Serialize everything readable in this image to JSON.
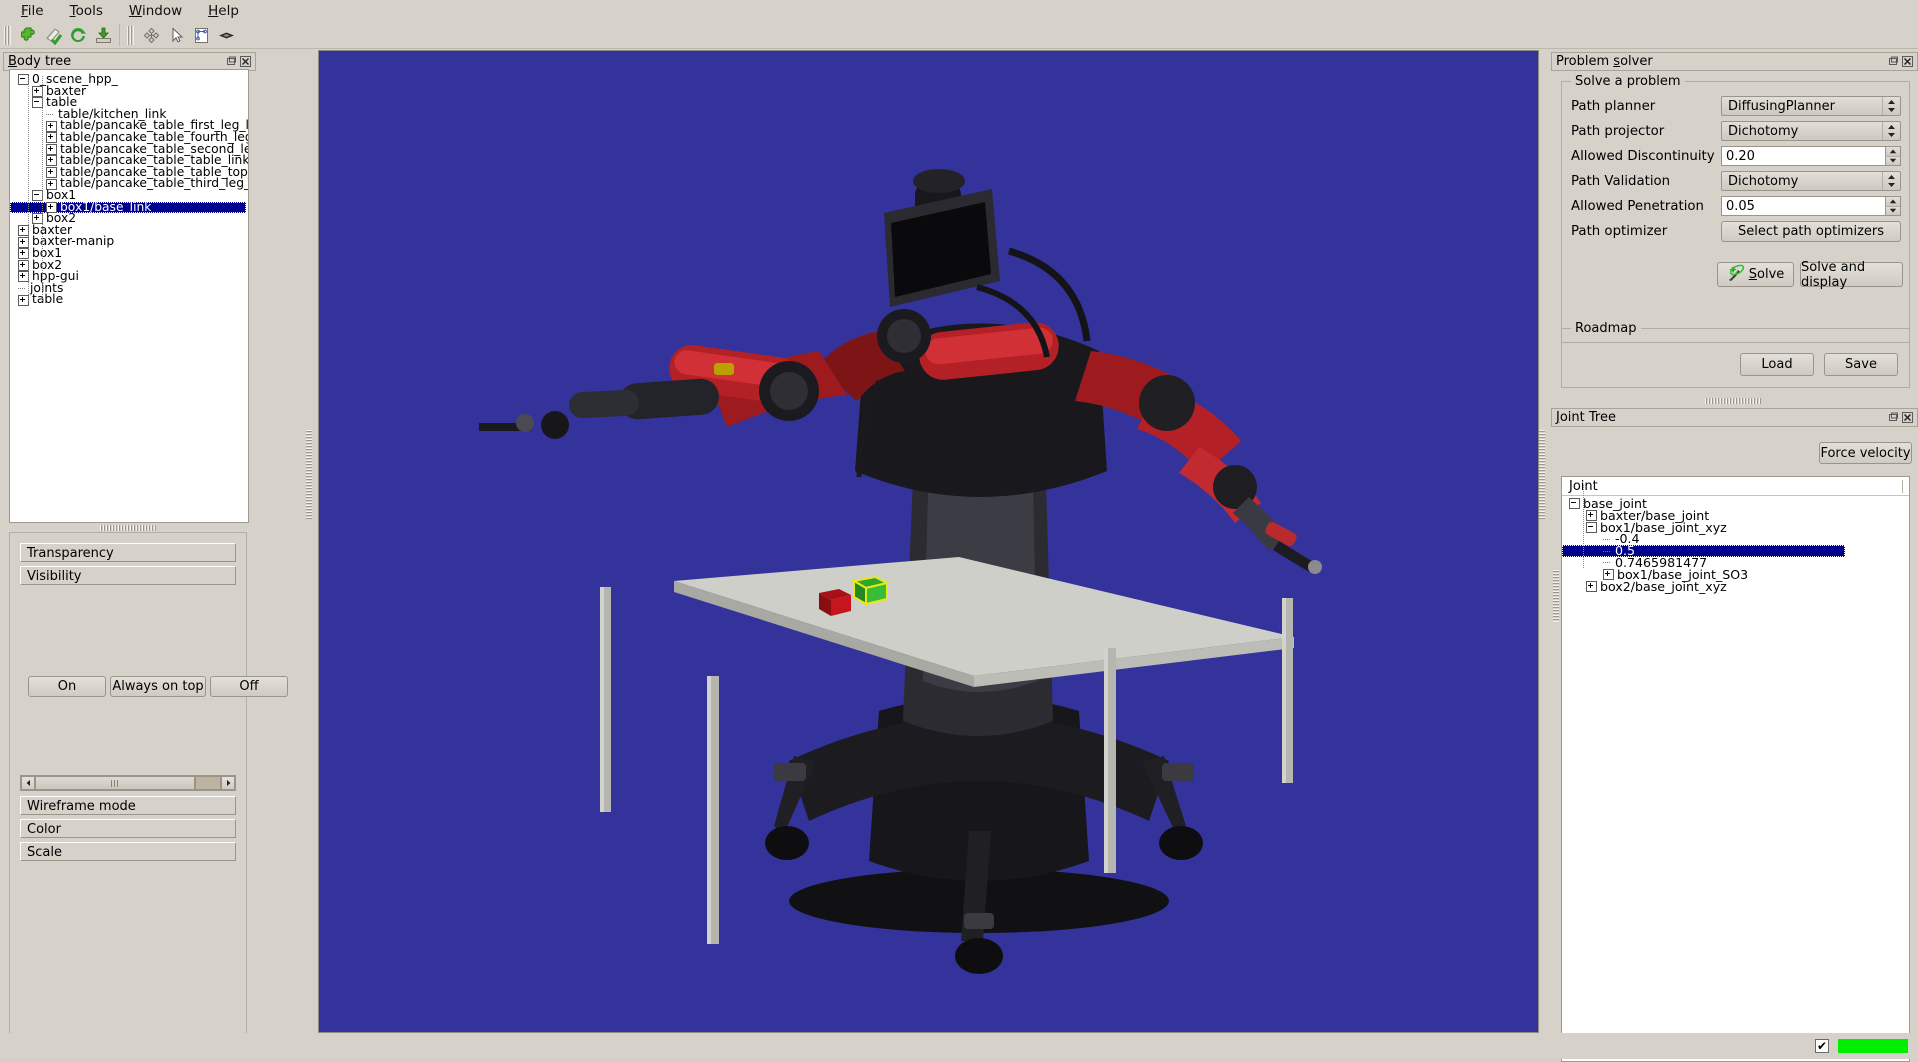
{
  "menu": {
    "items": [
      {
        "label": "File",
        "mnemonic": "F"
      },
      {
        "label": "Tools",
        "mnemonic": "T"
      },
      {
        "label": "Window",
        "mnemonic": "W"
      },
      {
        "label": "Help",
        "mnemonic": "H"
      }
    ]
  },
  "toolbar": {
    "icons": [
      {
        "name": "plugin-icon",
        "title": "Load plugin"
      },
      {
        "name": "refresh-check-icon",
        "title": "Refresh"
      },
      {
        "name": "reload-icon",
        "title": "Reload"
      },
      {
        "name": "import-icon",
        "title": "Import"
      },
      {
        "name": "move-tool-icon",
        "title": "Move"
      },
      {
        "name": "select-cursor-icon",
        "title": "Select"
      },
      {
        "name": "transform-node-icon",
        "title": "Transform"
      },
      {
        "name": "lens-icon",
        "title": "Camera"
      }
    ]
  },
  "body_tree_panel": {
    "title": "Body tree",
    "title_mnemonic": "B",
    "tree": [
      {
        "label": "0_scene_hpp_",
        "depth": 0,
        "state": "minus",
        "selected": false
      },
      {
        "label": "baxter",
        "depth": 1,
        "state": "plus",
        "selected": false
      },
      {
        "label": "table",
        "depth": 1,
        "state": "minus",
        "selected": false
      },
      {
        "label": "table/kitchen_link",
        "depth": 2,
        "state": "leaf",
        "selected": false
      },
      {
        "label": "table/pancake_table_first_leg_link",
        "depth": 2,
        "state": "plus",
        "selected": false
      },
      {
        "label": "table/pancake_table_fourth_leg_link",
        "depth": 2,
        "state": "plus",
        "selected": false
      },
      {
        "label": "table/pancake_table_second_leg_link",
        "depth": 2,
        "state": "plus",
        "selected": false
      },
      {
        "label": "table/pancake_table_table_link",
        "depth": 2,
        "state": "plus",
        "selected": false
      },
      {
        "label": "table/pancake_table_table_top_link",
        "depth": 2,
        "state": "plus",
        "selected": false
      },
      {
        "label": "table/pancake_table_third_leg_link",
        "depth": 2,
        "state": "plus",
        "selected": false
      },
      {
        "label": "box1",
        "depth": 1,
        "state": "minus",
        "selected": false
      },
      {
        "label": "box1/base_link",
        "depth": 2,
        "state": "plus",
        "selected": true
      },
      {
        "label": "box2",
        "depth": 1,
        "state": "plus",
        "selected": false
      },
      {
        "label": "baxter",
        "depth": 0,
        "state": "plus",
        "selected": false
      },
      {
        "label": "baxter-manip",
        "depth": 0,
        "state": "plus",
        "selected": false
      },
      {
        "label": "box1",
        "depth": 0,
        "state": "plus",
        "selected": false
      },
      {
        "label": "box2",
        "depth": 0,
        "state": "plus",
        "selected": false
      },
      {
        "label": "hpp-gui",
        "depth": 0,
        "state": "plus",
        "selected": false
      },
      {
        "label": "joints",
        "depth": 0,
        "state": "leaf",
        "selected": false
      },
      {
        "label": "table",
        "depth": 0,
        "state": "plus",
        "selected": false
      }
    ],
    "property_buttons": [
      "Transparency",
      "Visibility"
    ],
    "visibility_buttons": [
      "On",
      "Always on top",
      "Off"
    ],
    "bottom_buttons": [
      "Wireframe mode",
      "Color",
      "Scale"
    ]
  },
  "problem_solver_panel": {
    "title": "Problem solver",
    "title_mnemonic": "s",
    "solve_group_label": "Solve a problem",
    "fields": [
      {
        "label": "Path planner",
        "value": "DiffusingPlanner",
        "type": "combo"
      },
      {
        "label": "Path projector",
        "value": "Dichotomy",
        "type": "combo"
      },
      {
        "label": "Allowed Discontinuity",
        "value": "0.20",
        "type": "spin"
      },
      {
        "label": "Path Validation",
        "value": "Dichotomy",
        "type": "combo"
      },
      {
        "label": "Allowed Penetration",
        "value": "0.05",
        "type": "spin"
      },
      {
        "label": "Path optimizer",
        "value": "Select path optimizers",
        "type": "button"
      }
    ],
    "solve_button": "Solve",
    "solve_button_mnemonic": "S",
    "solve_display_button": "Solve and display",
    "roadmap_group_label": "Roadmap",
    "roadmap_load": "Load",
    "roadmap_save": "Save"
  },
  "joint_tree_panel": {
    "title": "Joint Tree",
    "title_mnemonic": "J",
    "force_velocity_button": "Force velocity",
    "column_header": "Joint",
    "tree": [
      {
        "label": "base_joint",
        "depth": 0,
        "state": "minus",
        "selected": false
      },
      {
        "label": "baxter/base_joint",
        "depth": 1,
        "state": "plus",
        "selected": false
      },
      {
        "label": "box1/base_joint_xyz",
        "depth": 1,
        "state": "minus",
        "selected": false
      },
      {
        "label": "-0.4",
        "depth": 2,
        "state": "leaf",
        "selected": false
      },
      {
        "label": "0.5",
        "depth": 2,
        "state": "leaf",
        "selected": true
      },
      {
        "label": "0.7465981477",
        "depth": 2,
        "state": "leaf",
        "selected": false
      },
      {
        "label": "box1/base_joint_SO3",
        "depth": 2,
        "state": "plus",
        "selected": false
      },
      {
        "label": "box2/base_joint_xyz",
        "depth": 1,
        "state": "plus",
        "selected": false
      }
    ]
  },
  "viewport": {
    "name": "3d-scene-viewport",
    "description": "Baxter robot behind a table with a red cube and a green-yellow cube",
    "background_color": "#33339b"
  },
  "statusbar": {
    "checkbox_checked": "✔",
    "indicator_color": "#00ee00"
  },
  "colors": {
    "panel_bg": "#d6d2ca",
    "selection": "#00008f",
    "viewport_bg": "#33339b",
    "status_green": "#00ee00"
  }
}
